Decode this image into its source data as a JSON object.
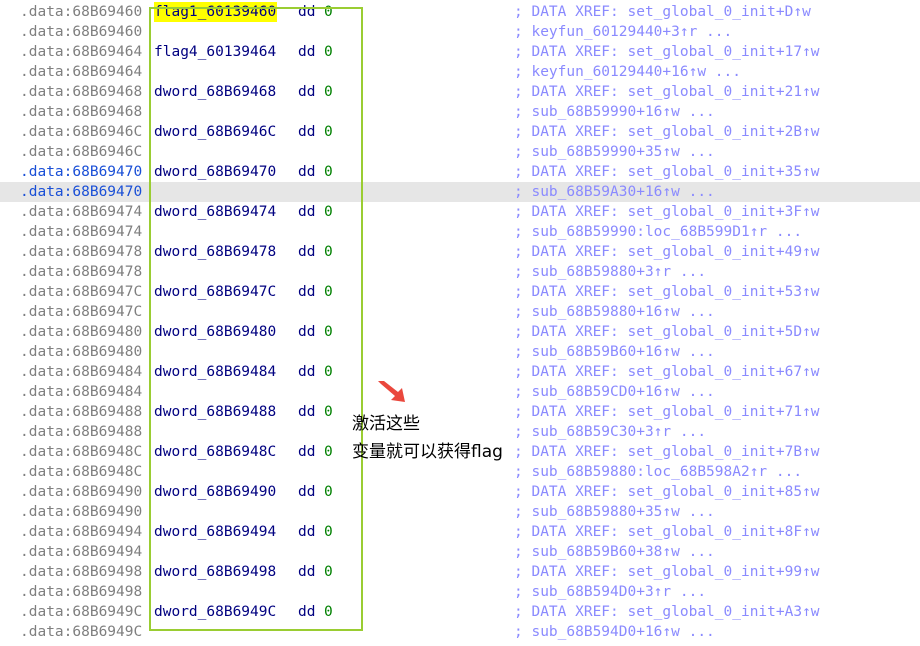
{
  "colors": {
    "address": "#7f7f7f",
    "address_highlight": "#1a4fd6",
    "name": "#000080",
    "value": "#008000",
    "comment": "#8a8aff",
    "highlight_line": "#e6e6e6",
    "highlight_name": "#ffff00",
    "box": "#9acd32",
    "arrow": "#e8382c"
  },
  "annotation": {
    "line1": "激活这些",
    "line2": "变量就可以获得flag"
  },
  "lines": [
    {
      "addr": ".data:68B69460",
      "name": "flag1_60139460",
      "dd": "dd",
      "val": "0",
      "comment": "; DATA XREF: set_global_0_init+D↑w"
    },
    {
      "addr": ".data:68B69460",
      "comment": "; keyfun_60129440+3↑r ..."
    },
    {
      "addr": ".data:68B69464",
      "name": "flag4_60139464",
      "dd": "dd",
      "val": "0",
      "comment": "; DATA XREF: set_global_0_init+17↑w"
    },
    {
      "addr": ".data:68B69464",
      "comment": "; keyfun_60129440+16↑w ..."
    },
    {
      "addr": ".data:68B69468",
      "name": "dword_68B69468",
      "dd": "dd",
      "val": "0",
      "comment": "; DATA XREF: set_global_0_init+21↑w"
    },
    {
      "addr": ".data:68B69468",
      "comment": "; sub_68B59990+16↑w ..."
    },
    {
      "addr": ".data:68B6946C",
      "name": "dword_68B6946C",
      "dd": "dd",
      "val": "0",
      "comment": "; DATA XREF: set_global_0_init+2B↑w"
    },
    {
      "addr": ".data:68B6946C",
      "comment": "; sub_68B59990+35↑w ..."
    },
    {
      "addr": ".data:68B69470",
      "name": "dword_68B69470",
      "dd": "dd",
      "val": "0",
      "comment": "; DATA XREF: set_global_0_init+35↑w"
    },
    {
      "addr": ".data:68B69470",
      "comment": "; sub_68B59A30+16↑w ..."
    },
    {
      "addr": ".data:68B69474",
      "name": "dword_68B69474",
      "dd": "dd",
      "val": "0",
      "comment": "; DATA XREF: set_global_0_init+3F↑w"
    },
    {
      "addr": ".data:68B69474",
      "comment": "; sub_68B59990:loc_68B599D1↑r ..."
    },
    {
      "addr": ".data:68B69478",
      "name": "dword_68B69478",
      "dd": "dd",
      "val": "0",
      "comment": "; DATA XREF: set_global_0_init+49↑w"
    },
    {
      "addr": ".data:68B69478",
      "comment": "; sub_68B59880+3↑r ..."
    },
    {
      "addr": ".data:68B6947C",
      "name": "dword_68B6947C",
      "dd": "dd",
      "val": "0",
      "comment": "; DATA XREF: set_global_0_init+53↑w"
    },
    {
      "addr": ".data:68B6947C",
      "comment": "; sub_68B59880+16↑w ..."
    },
    {
      "addr": ".data:68B69480",
      "name": "dword_68B69480",
      "dd": "dd",
      "val": "0",
      "comment": "; DATA XREF: set_global_0_init+5D↑w"
    },
    {
      "addr": ".data:68B69480",
      "comment": "; sub_68B59B60+16↑w ..."
    },
    {
      "addr": ".data:68B69484",
      "name": "dword_68B69484",
      "dd": "dd",
      "val": "0",
      "comment": "; DATA XREF: set_global_0_init+67↑w"
    },
    {
      "addr": ".data:68B69484",
      "comment": "; sub_68B59CD0+16↑w ..."
    },
    {
      "addr": ".data:68B69488",
      "name": "dword_68B69488",
      "dd": "dd",
      "val": "0",
      "comment": "; DATA XREF: set_global_0_init+71↑w"
    },
    {
      "addr": ".data:68B69488",
      "comment": "; sub_68B59C30+3↑r ..."
    },
    {
      "addr": ".data:68B6948C",
      "name": "dword_68B6948C",
      "dd": "dd",
      "val": "0",
      "comment": "; DATA XREF: set_global_0_init+7B↑w"
    },
    {
      "addr": ".data:68B6948C",
      "comment": "; sub_68B59880:loc_68B598A2↑r ..."
    },
    {
      "addr": ".data:68B69490",
      "name": "dword_68B69490",
      "dd": "dd",
      "val": "0",
      "comment": "; DATA XREF: set_global_0_init+85↑w"
    },
    {
      "addr": ".data:68B69490",
      "comment": "; sub_68B59880+35↑w ..."
    },
    {
      "addr": ".data:68B69494",
      "name": "dword_68B69494",
      "dd": "dd",
      "val": "0",
      "comment": "; DATA XREF: set_global_0_init+8F↑w"
    },
    {
      "addr": ".data:68B69494",
      "comment": "; sub_68B59B60+38↑w ..."
    },
    {
      "addr": ".data:68B69498",
      "name": "dword_68B69498",
      "dd": "dd",
      "val": "0",
      "comment": "; DATA XREF: set_global_0_init+99↑w"
    },
    {
      "addr": ".data:68B69498",
      "comment": "; sub_68B594D0+3↑r ..."
    },
    {
      "addr": ".data:68B6949C",
      "name": "dword_68B6949C",
      "dd": "dd",
      "val": "0",
      "comment": "; DATA XREF: set_global_0_init+A3↑w"
    },
    {
      "addr": ".data:68B6949C",
      "comment": "; sub_68B594D0+16↑w ..."
    }
  ]
}
